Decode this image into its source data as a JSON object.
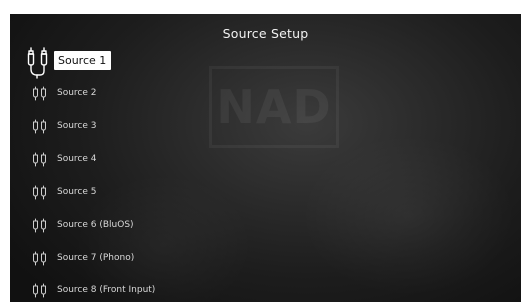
{
  "screen": {
    "title": "Source Setup",
    "watermark_text": "NAD"
  },
  "sources": [
    {
      "label": "Source 1",
      "icon": "rca-plug-icon",
      "selected": true
    },
    {
      "label": "Source 2",
      "icon": "rca-plug-icon",
      "selected": false
    },
    {
      "label": "Source 3",
      "icon": "rca-plug-icon",
      "selected": false
    },
    {
      "label": "Source 4",
      "icon": "rca-plug-icon",
      "selected": false
    },
    {
      "label": "Source 5",
      "icon": "rca-plug-icon",
      "selected": false
    },
    {
      "label": "Source 6 (BluOS)",
      "icon": "rca-plug-icon",
      "selected": false
    },
    {
      "label": "Source 7 (Phono)",
      "icon": "rca-plug-icon",
      "selected": false
    },
    {
      "label": "Source 8 (Front Input)",
      "icon": "rca-plug-icon",
      "selected": false
    }
  ],
  "colors": {
    "text": "#d8d8d8",
    "title": "#f2f2f2",
    "highlight_bg": "#ffffff",
    "highlight_text": "#111111"
  }
}
